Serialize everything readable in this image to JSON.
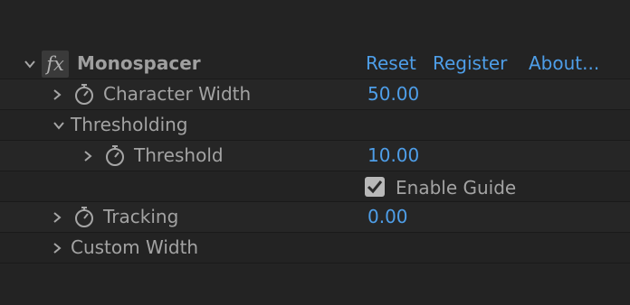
{
  "effect": {
    "name": "Monospacer",
    "icon": "fx-icon",
    "links": {
      "reset": "Reset",
      "register": "Register",
      "about": "About..."
    }
  },
  "properties": {
    "character_width": {
      "label": "Character Width",
      "value": "50.00"
    },
    "thresholding": {
      "label": "Thresholding"
    },
    "threshold": {
      "label": "Threshold",
      "value": "10.00"
    },
    "enable_guide": {
      "label": "Enable Guide",
      "checked": true
    },
    "tracking": {
      "label": "Tracking",
      "value": "0.00"
    },
    "custom_width": {
      "label": "Custom Width"
    }
  },
  "colors": {
    "background": "#232323",
    "value_blue": "#4e9ee8",
    "label_gray": "#a3a3a3"
  }
}
